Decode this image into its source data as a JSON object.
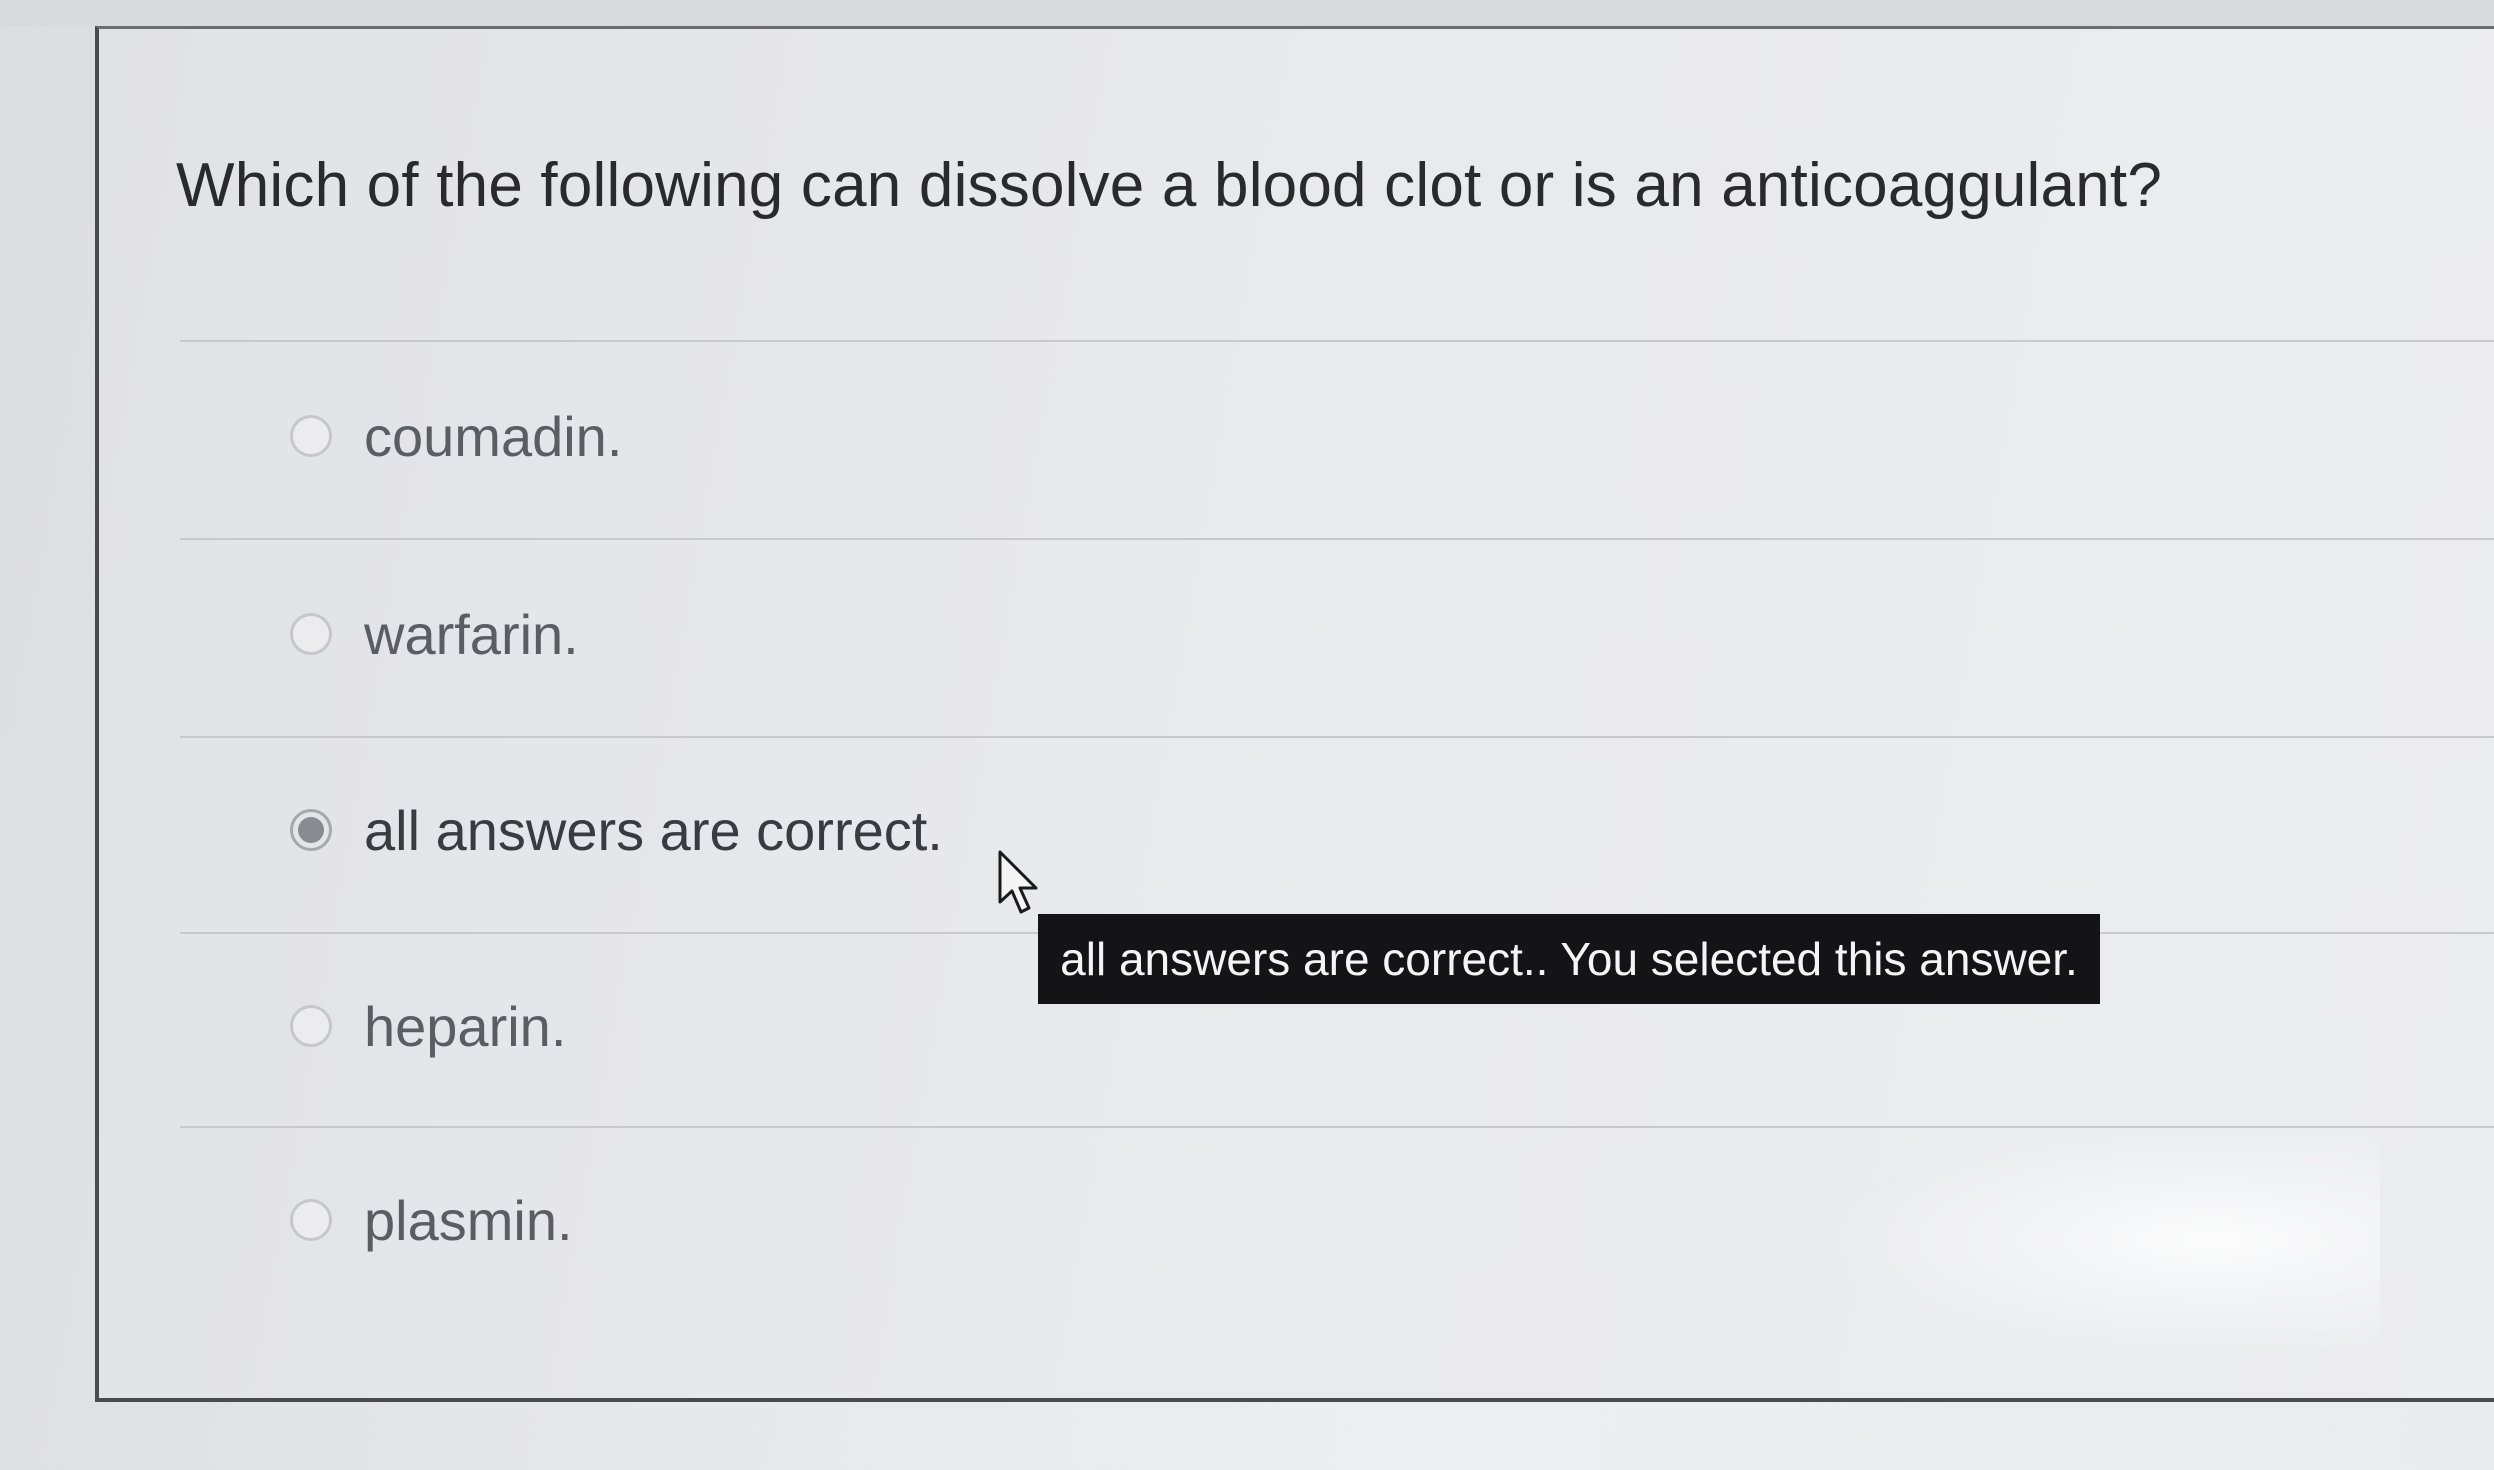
{
  "question": {
    "text": "Which of the following can dissolve a blood clot or is an anticoaggulant?"
  },
  "options": [
    {
      "label": "coumadin.",
      "selected": false
    },
    {
      "label": "warfarin.",
      "selected": false
    },
    {
      "label": "all answers are correct.",
      "selected": true
    },
    {
      "label": "heparin.",
      "selected": false
    },
    {
      "label": "plasmin.",
      "selected": false
    }
  ],
  "tooltip": {
    "text": "all answers are correct.. You selected this answer."
  },
  "colors": {
    "tooltip_bg": "#141416",
    "selected_dot": "#8a8b90"
  },
  "icons": {
    "cursor": "mouse-pointer-icon"
  }
}
